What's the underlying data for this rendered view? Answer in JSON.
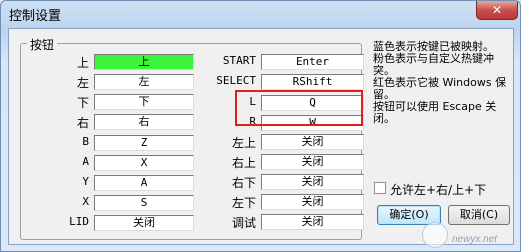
{
  "window": {
    "title": "控制设置",
    "close_label": "✕"
  },
  "group": {
    "legend": "按钮"
  },
  "left_column": [
    {
      "label": "上",
      "value": "上",
      "active": true
    },
    {
      "label": "左",
      "value": "左"
    },
    {
      "label": "下",
      "value": "下"
    },
    {
      "label": "右",
      "value": "右"
    },
    {
      "label": "B",
      "value": "Z"
    },
    {
      "label": "A",
      "value": "X"
    },
    {
      "label": "Y",
      "value": "A"
    },
    {
      "label": "X",
      "value": "S"
    },
    {
      "label": "LID",
      "value": "关闭"
    }
  ],
  "right_column": [
    {
      "label": "START",
      "value": "Enter"
    },
    {
      "label": "SELECT",
      "value": "RShift"
    },
    {
      "label": "L",
      "value": "Q"
    },
    {
      "label": "R",
      "value": "W"
    },
    {
      "label": "左上",
      "value": "关闭"
    },
    {
      "label": "右上",
      "value": "关闭"
    },
    {
      "label": "右下",
      "value": "关闭"
    },
    {
      "label": "左下",
      "value": "关闭"
    },
    {
      "label": "调试",
      "value": "关闭"
    }
  ],
  "info_text": "蓝色表示按键已被映射。\n粉色表示与自定义热键冲突。\n红色表示它被 Windows 保留。\n按钮可以使用 Escape 关闭。",
  "checkbox": {
    "label": "允许左+右/上+下",
    "checked": false
  },
  "buttons": {
    "ok": "确定(O)",
    "cancel": "取消(C)"
  },
  "watermark": {
    "text": "newyx.net"
  },
  "colors": {
    "active_field": "#3cf43c",
    "highlight_box": "#e02020"
  }
}
